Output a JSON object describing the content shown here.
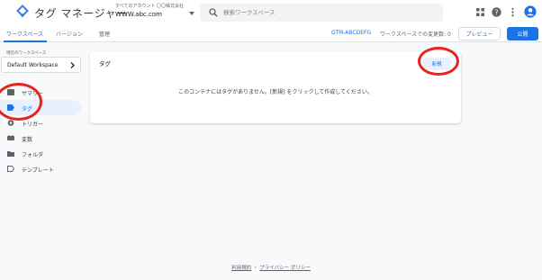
{
  "header": {
    "app_title": "タグ マネージャー",
    "account_label": "すべてのアカウント  〇〇株式会社",
    "container_domain": "WWW.abc.com",
    "search_placeholder": "検索ワークスペース"
  },
  "icons": {
    "logo": "gtm-logo-icon",
    "search": "search-icon",
    "apps": "apps-grid-icon",
    "help": "help-icon",
    "more": "more-vert-icon",
    "account": "account-circle-icon"
  },
  "subnav": {
    "tabs": [
      {
        "label": "ワークスペース",
        "active": true
      },
      {
        "label": "バージョン",
        "active": false
      },
      {
        "label": "管理",
        "active": false
      }
    ],
    "container_id": "GTM-ABCDEFG",
    "changes_text": "ワークスペースでの変更数: 0",
    "preview_label": "プレビュー",
    "publish_label": "公開"
  },
  "sidebar": {
    "workspace_label": "現在のワークスペース",
    "workspace_name": "Default Workspace",
    "items": [
      {
        "label": "サマリー",
        "icon": "summary-icon",
        "active": false
      },
      {
        "label": "タグ",
        "icon": "tag-icon",
        "active": true
      },
      {
        "label": "トリガー",
        "icon": "trigger-icon",
        "active": false
      },
      {
        "label": "変数",
        "icon": "variable-icon",
        "active": false
      },
      {
        "label": "フォルダ",
        "icon": "folder-icon",
        "active": false
      },
      {
        "label": "テンプレート",
        "icon": "template-icon",
        "active": false
      }
    ]
  },
  "main": {
    "card_title": "タグ",
    "new_button": "新規",
    "empty_message": "このコンテナにはタグがありません。[新規] をクリックして作成してください。"
  },
  "footer": {
    "terms": "利用規約",
    "separator": "・",
    "privacy": "プライバシー ポリシー"
  },
  "colors": {
    "accent": "#1a73e8",
    "annotation": "#e8231c",
    "active_nav_bg": "#e8f0fe"
  }
}
